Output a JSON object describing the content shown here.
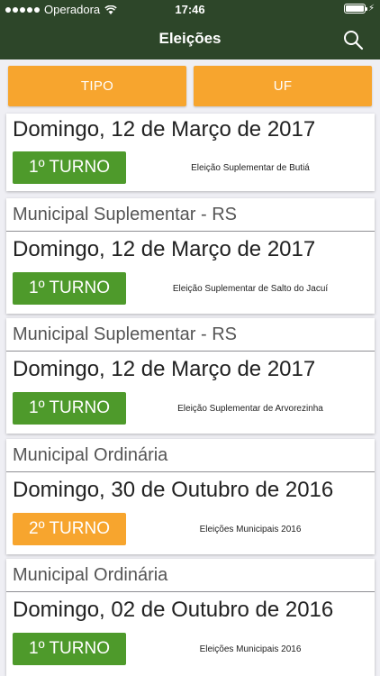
{
  "status_bar": {
    "carrier": "Operadora",
    "time": "17:46"
  },
  "nav": {
    "title": "Eleições",
    "search_icon": "search-icon"
  },
  "filters": {
    "tipo": "TIPO",
    "uf": "UF"
  },
  "elections": [
    {
      "category": "",
      "date": "Domingo, 12 de Março de 2017",
      "turno": "1º TURNO",
      "description": "Eleição Suplementar de Butiá"
    },
    {
      "category": "Municipal Suplementar - RS",
      "date": "Domingo, 12 de Março de 2017",
      "turno": "1º TURNO",
      "description": "Eleição Suplementar de Salto do Jacuí"
    },
    {
      "category": "Municipal Suplementar - RS",
      "date": "Domingo, 12 de Março de 2017",
      "turno": "1º TURNO",
      "description": "Eleição Suplementar de Arvorezinha"
    },
    {
      "category": "Municipal Ordinária",
      "date": "Domingo, 30 de Outubro de 2016",
      "turno": "2º TURNO",
      "description": "Eleições Municipais 2016"
    },
    {
      "category": "Municipal Ordinária",
      "date": "Domingo, 02 de Outubro de 2016",
      "turno": "1º TURNO",
      "description": "Eleições Municipais 2016"
    }
  ],
  "colors": {
    "header": "#2d4629",
    "filter": "#f7a52e",
    "turno1": "#4e9a2b",
    "turno2": "#f7a52e"
  }
}
